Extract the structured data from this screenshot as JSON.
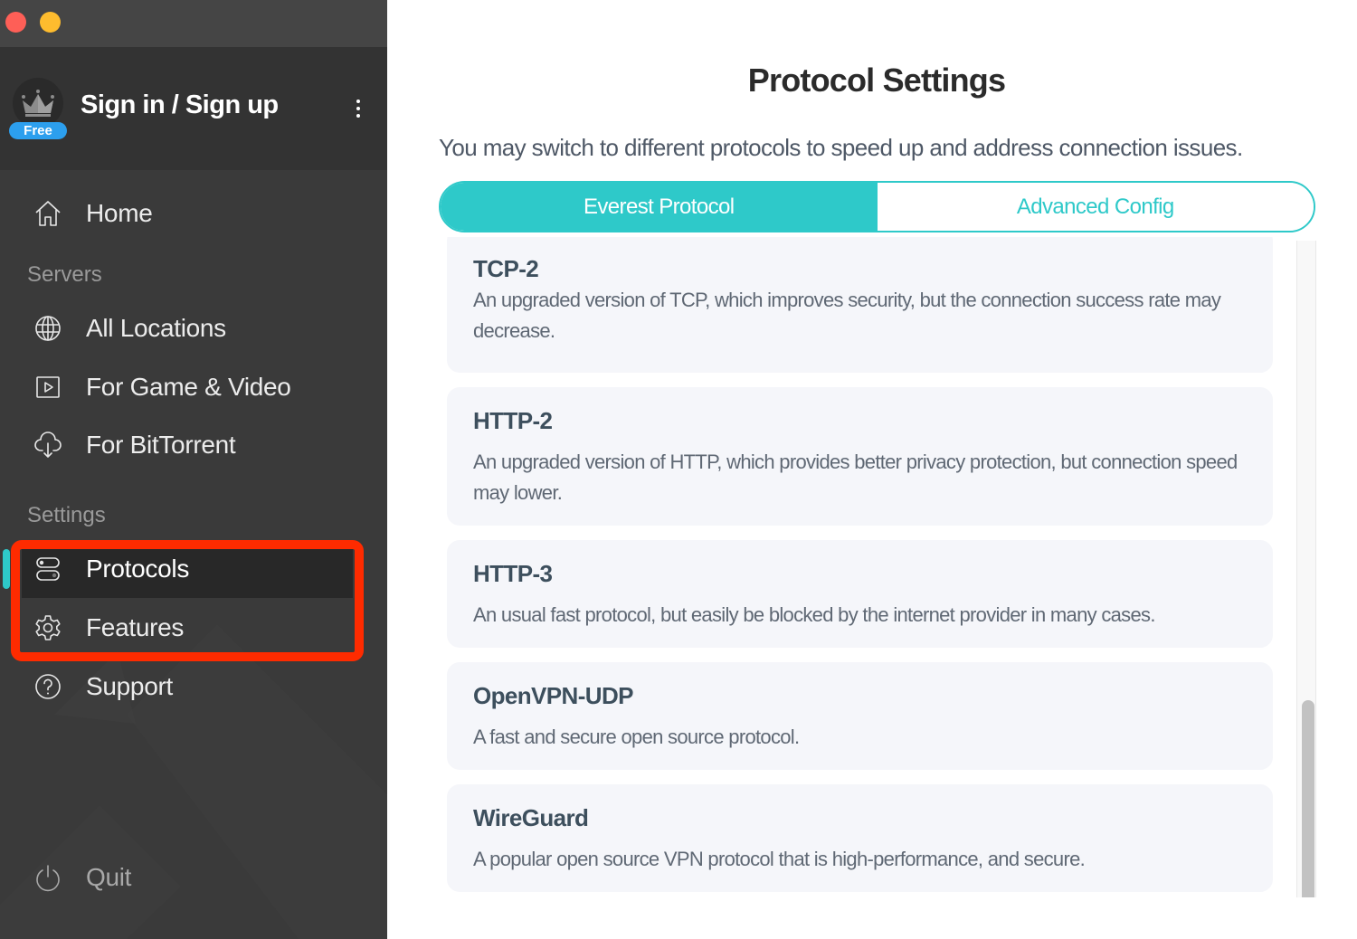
{
  "window": {
    "traffic_lights": [
      "close",
      "minimize"
    ]
  },
  "account": {
    "title": "Sign in / Sign up",
    "badge": "Free",
    "avatar_icon": "crown-icon",
    "menu_icon": "more-vertical-icon"
  },
  "sidebar": {
    "home": {
      "label": "Home",
      "icon": "home-icon"
    },
    "servers_section": "Servers",
    "servers": [
      {
        "label": "All Locations",
        "icon": "globe-icon"
      },
      {
        "label": "For Game & Video",
        "icon": "play-icon"
      },
      {
        "label": "For BitTorrent",
        "icon": "cloud-download-icon"
      }
    ],
    "settings_section": "Settings",
    "settings": [
      {
        "label": "Protocols",
        "icon": "toggles-icon",
        "active": true
      },
      {
        "label": "Features",
        "icon": "gear-icon",
        "active": false
      }
    ],
    "support": {
      "label": "Support",
      "icon": "help-circle-icon"
    },
    "quit": {
      "label": "Quit",
      "icon": "power-icon"
    }
  },
  "main": {
    "title": "Protocol Settings",
    "subtitle": "You may switch to different protocols to speed up and address connection issues.",
    "tabs": [
      {
        "label": "Everest Protocol",
        "active": true
      },
      {
        "label": "Advanced Config",
        "active": false
      }
    ],
    "protocols": [
      {
        "name": "TCP-2",
        "description": "An upgraded version of TCP, which improves security, but the connection success rate may decrease."
      },
      {
        "name": "HTTP-2",
        "description": "An upgraded version of HTTP, which provides better privacy protection, but connection speed may lower."
      },
      {
        "name": "HTTP-3",
        "description": "An usual fast protocol, but easily be blocked by the internet provider in many cases."
      },
      {
        "name": "OpenVPN-UDP",
        "description": "A fast and secure open source protocol."
      },
      {
        "name": "WireGuard",
        "description": "A popular open source VPN protocol that is high-performance, and secure."
      }
    ],
    "scroll": {
      "position_fraction": 1.0,
      "visible_fraction": 0.3
    }
  },
  "colors": {
    "accent": "#2ec9c9",
    "highlight": "#fe2b00",
    "badge": "#2c9fee",
    "sidebar_bg": "#3a3a3a",
    "card_bg": "#f5f6fa"
  }
}
